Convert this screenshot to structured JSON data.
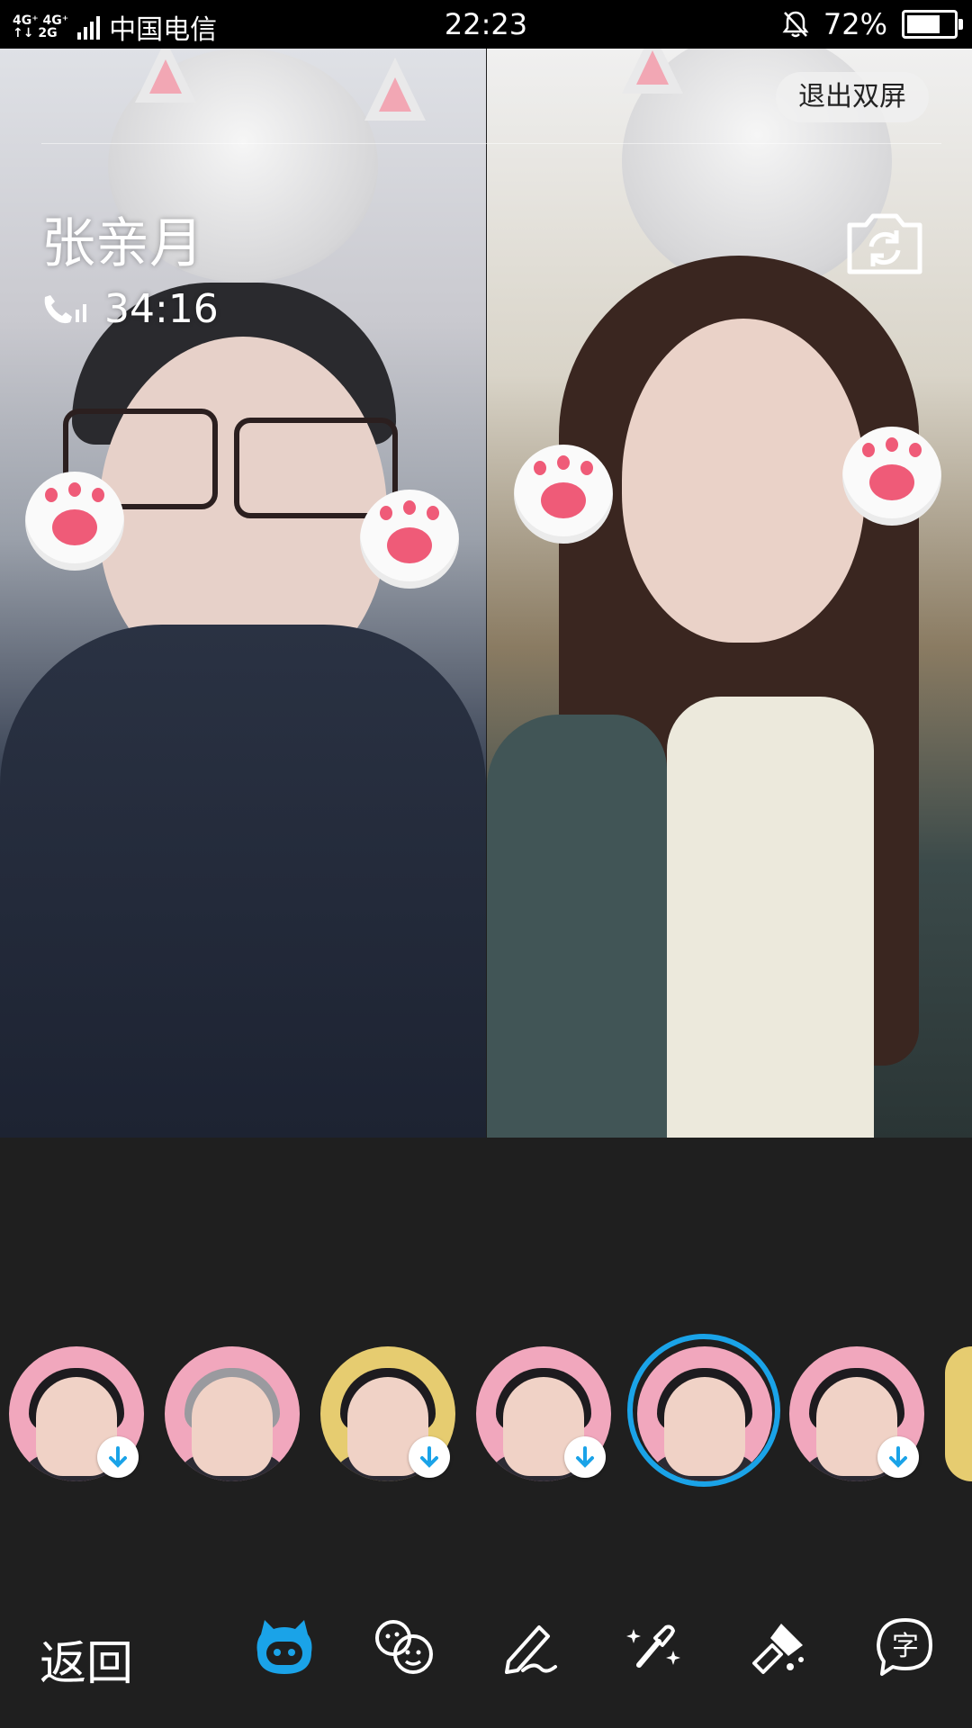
{
  "status_bar": {
    "network_top": "4G⁺ 4G⁺",
    "network_bottom": "↑↓ 2G",
    "carrier": "中国电信",
    "time": "22:23",
    "battery": "72%",
    "battery_level": 0.72,
    "icons": [
      "signal-icon",
      "bell-mute-icon",
      "battery-icon"
    ]
  },
  "call": {
    "caller_name": "张亲月",
    "duration": "34:16",
    "exit_dual_label": "退出双屏"
  },
  "stickers": [
    {
      "name": "cat-ears-sticker",
      "bg": "#f1a7bd",
      "downloadable": true,
      "selected": false
    },
    {
      "name": "floral-crown-sticker",
      "bg": "#f1a7bd",
      "downloadable": false,
      "selected": false
    },
    {
      "name": "bunny-ears-sticker",
      "bg": "#e6cc70",
      "downloadable": true,
      "selected": false
    },
    {
      "name": "bow-sticker",
      "bg": "#f1a7bd",
      "downloadable": true,
      "selected": false
    },
    {
      "name": "cat-head-sticker",
      "bg": "#f1a7bd",
      "downloadable": false,
      "selected": true
    },
    {
      "name": "antlers-sticker",
      "bg": "#f1a7bd",
      "downloadable": true,
      "selected": false
    },
    {
      "name": "partial-sticker",
      "bg": "#e6cc70",
      "downloadable": false,
      "selected": false
    }
  ],
  "toolbar": {
    "back_label": "返回",
    "tools": [
      "sticker-icon",
      "face-filter-icon",
      "doodle-icon",
      "beauty-icon",
      "effects-icon",
      "subtitle-icon"
    ]
  },
  "colors": {
    "accent": "#1aa3e8",
    "panel_bg": "#1f1f1f"
  }
}
